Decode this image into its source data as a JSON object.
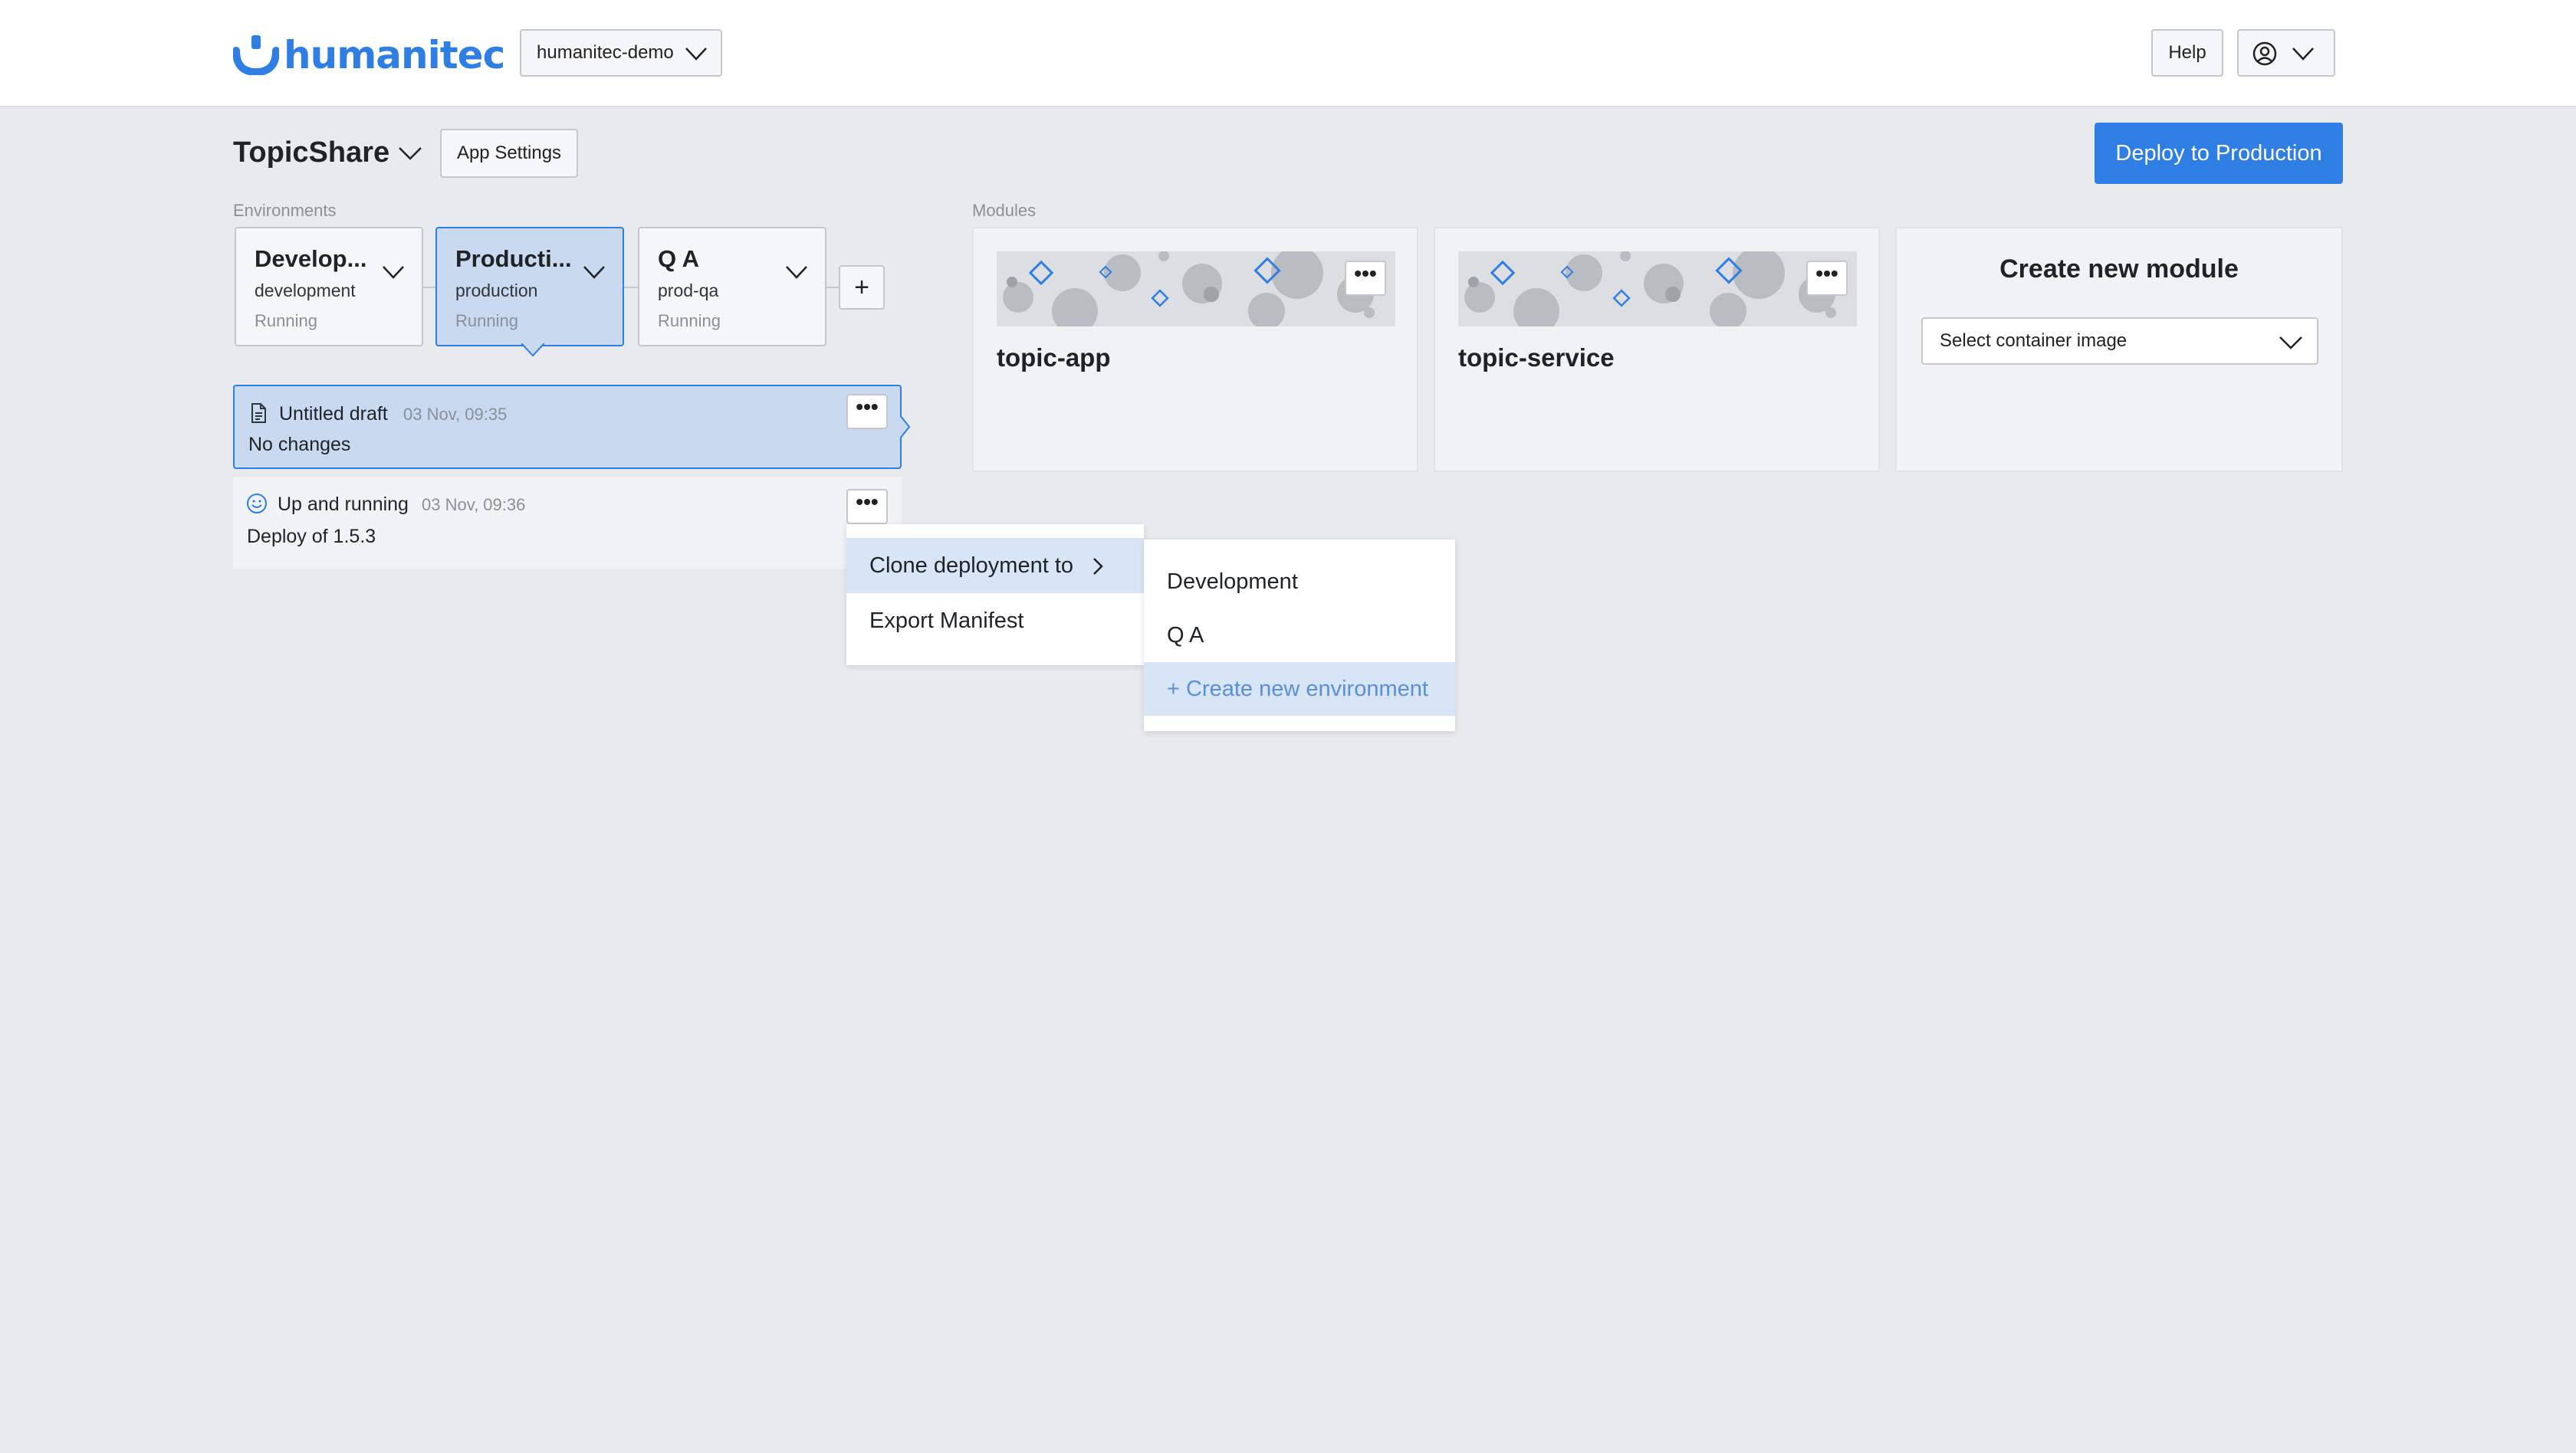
{
  "topbar": {
    "brand": "humanitec",
    "org": "humanitec-demo",
    "help_label": "Help"
  },
  "app": {
    "title": "TopicShare",
    "settings_label": "App Settings",
    "deploy_label": "Deploy to Production"
  },
  "environments": {
    "label": "Environments",
    "items": [
      {
        "name": "Develop...",
        "id": "development",
        "status": "Running"
      },
      {
        "name": "Producti...",
        "id": "production",
        "status": "Running",
        "selected": true
      },
      {
        "name": "Q A",
        "id": "prod-qa",
        "status": "Running"
      }
    ],
    "add_label": "+"
  },
  "deployments": [
    {
      "title": "Untitled draft",
      "time": "03 Nov, 09:35",
      "subtitle": "No changes",
      "icon": "document-icon"
    },
    {
      "title": "Up and running",
      "time": "03 Nov, 09:36",
      "subtitle": "Deploy of 1.5.3",
      "icon": "smiley-icon"
    }
  ],
  "more_label": "•••",
  "modules": {
    "label": "Modules",
    "items": [
      {
        "name": "topic-app"
      },
      {
        "name": "topic-service"
      }
    ],
    "create_title": "Create new module",
    "container_placeholder": "Select container image"
  },
  "context_menu": {
    "items": [
      "Clone deployment to",
      "Export Manifest"
    ]
  },
  "clone_submenu": {
    "items": [
      "Development",
      "Q A"
    ],
    "create_label": "+ Create new environment"
  },
  "colors": {
    "accent": "#2f7ee3",
    "selected_bg": "#c9d9ef",
    "page_bg": "#e8eaee"
  }
}
